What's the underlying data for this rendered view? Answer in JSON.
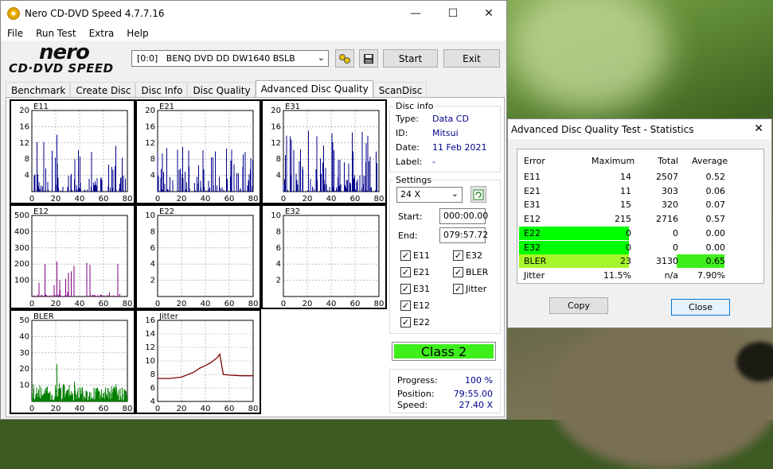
{
  "app": {
    "title": "Nero CD-DVD Speed 4.7.7.16",
    "menu": [
      "File",
      "Run Test",
      "Extra",
      "Help"
    ],
    "logo_text": "nero",
    "logo_sub": "CD·DVD SPEED"
  },
  "toolbar": {
    "drive": "[0:0]   BENQ DVD DD DW1640 BSLB",
    "start_label": "Start",
    "exit_label": "Exit"
  },
  "tabs": [
    "Benchmark",
    "Create Disc",
    "Disc Info",
    "Disc Quality",
    "Advanced Disc Quality",
    "ScanDisc"
  ],
  "active_tab": "Advanced Disc Quality",
  "disc_info": {
    "label": "Disc info",
    "type_label": "Type:",
    "type_value": "Data CD",
    "id_label": "ID:",
    "id_value": "Mitsui",
    "date_label": "Date:",
    "date_value": "11 Feb 2021",
    "disc_label_label": "Label:",
    "disc_label_value": "-"
  },
  "settings": {
    "label": "Settings",
    "speed": "24 X",
    "start_label": "Start:",
    "start_value": "000:00.00",
    "end_label": "End:",
    "end_value": "079:57.72",
    "checks": [
      {
        "label": "E11",
        "checked": true
      },
      {
        "label": "E32",
        "checked": true
      },
      {
        "label": "E21",
        "checked": true
      },
      {
        "label": "BLER",
        "checked": true
      },
      {
        "label": "E31",
        "checked": true
      },
      {
        "label": "Jitter",
        "checked": true
      },
      {
        "label": "E12",
        "checked": true
      },
      {
        "label": "E22",
        "checked": true
      }
    ]
  },
  "class_label": "Class 2",
  "progress": {
    "progress_label": "Progress:",
    "progress_value": "100 %",
    "position_label": "Position:",
    "position_value": "79:55.00",
    "speed_label": "Speed:",
    "speed_value": "27.40 X"
  },
  "stats": {
    "title": "Advanced Disc Quality Test - Statistics",
    "headers": [
      "Error",
      "Maximum",
      "Total",
      "Average"
    ],
    "rows": [
      {
        "name": "E11",
        "max": "14",
        "total": "2507",
        "avg": "0.52"
      },
      {
        "name": "E21",
        "max": "11",
        "total": "303",
        "avg": "0.06"
      },
      {
        "name": "E31",
        "max": "15",
        "total": "320",
        "avg": "0.07"
      },
      {
        "name": "E12",
        "max": "215",
        "total": "2716",
        "avg": "0.57"
      },
      {
        "name": "E22",
        "max": "0",
        "total": "0",
        "avg": "0.00"
      },
      {
        "name": "E32",
        "max": "0",
        "total": "0",
        "avg": "0.00"
      },
      {
        "name": "BLER",
        "max": "23",
        "total": "3130",
        "avg": "0.65"
      },
      {
        "name": "Jitter",
        "max": "11.5%",
        "total": "n/a",
        "avg": "7.90%"
      }
    ],
    "copy_label": "Copy",
    "close_label": "Close"
  },
  "colors": {
    "bar": "#00008b",
    "bler": "#008000",
    "jitter": "#800000",
    "e12": "#800080",
    "class": "#3fef1c",
    "highlight": "#00ff00"
  },
  "chart_data": [
    {
      "type": "bar",
      "title": "E11",
      "yticks": [
        4,
        8,
        12,
        16,
        20
      ],
      "xticks": [
        0,
        20,
        40,
        60,
        80
      ],
      "ylim": [
        0,
        20
      ],
      "xlim": [
        0,
        80
      ],
      "max": 14
    },
    {
      "type": "bar",
      "title": "E21",
      "yticks": [
        4,
        8,
        12,
        16,
        20
      ],
      "xticks": [
        0,
        20,
        40,
        60,
        80
      ],
      "ylim": [
        0,
        20
      ],
      "xlim": [
        0,
        80
      ],
      "max": 11
    },
    {
      "type": "bar",
      "title": "E31",
      "yticks": [
        4,
        8,
        12,
        16,
        20
      ],
      "xticks": [
        0,
        20,
        40,
        60,
        80
      ],
      "ylim": [
        0,
        20
      ],
      "xlim": [
        0,
        80
      ],
      "max": 15
    },
    {
      "type": "bar",
      "title": "E12",
      "yticks": [
        100,
        200,
        300,
        400,
        500
      ],
      "xticks": [
        0,
        20,
        40,
        60,
        80
      ],
      "ylim": [
        0,
        500
      ],
      "xlim": [
        0,
        80
      ],
      "max": 215
    },
    {
      "type": "bar",
      "title": "E22",
      "yticks": [
        2,
        4,
        6,
        8,
        10
      ],
      "xticks": [
        0,
        20,
        40,
        60,
        80
      ],
      "ylim": [
        0,
        10
      ],
      "xlim": [
        0,
        80
      ],
      "max": 0
    },
    {
      "type": "bar",
      "title": "E32",
      "yticks": [
        2,
        4,
        6,
        8,
        10
      ],
      "xticks": [
        0,
        20,
        40,
        60,
        80
      ],
      "ylim": [
        0,
        10
      ],
      "xlim": [
        0,
        80
      ],
      "max": 0
    },
    {
      "type": "bar",
      "title": "BLER",
      "yticks": [
        10,
        20,
        30,
        40,
        50
      ],
      "xticks": [
        0,
        20,
        40,
        60,
        80
      ],
      "ylim": [
        0,
        50
      ],
      "xlim": [
        0,
        80
      ],
      "max": 23
    },
    {
      "type": "line",
      "title": "Jitter",
      "yticks": [
        4,
        6,
        8,
        10,
        12,
        14,
        16
      ],
      "xticks": [
        0,
        20,
        40,
        60,
        80
      ],
      "ylim": [
        4,
        16
      ],
      "xlim": [
        0,
        80
      ],
      "x": [
        0,
        10,
        20,
        30,
        35,
        40,
        45,
        50,
        52,
        55,
        60,
        70,
        80
      ],
      "y": [
        7.4,
        7.4,
        7.6,
        8.3,
        8.9,
        9.3,
        9.8,
        10.5,
        11.0,
        8.0,
        7.9,
        7.8,
        7.8
      ]
    }
  ]
}
